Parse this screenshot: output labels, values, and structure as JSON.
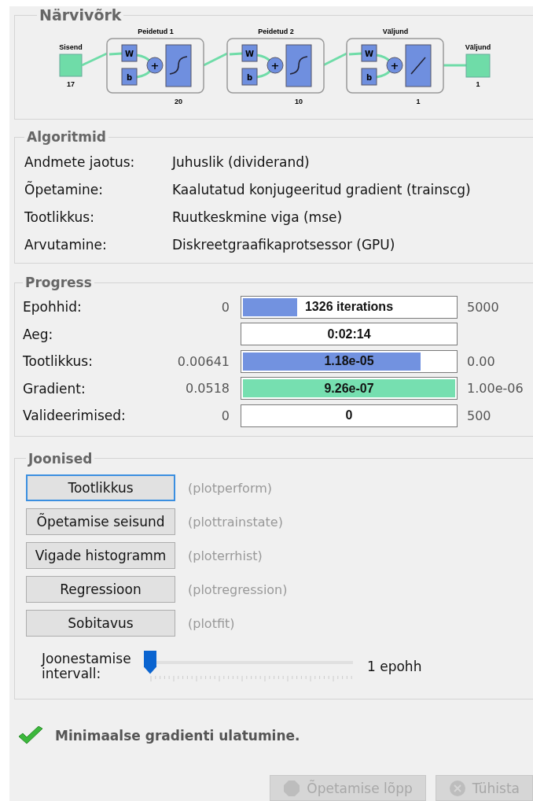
{
  "network": {
    "title": "Närvivõrk",
    "input": {
      "label": "Sisend",
      "size": "17"
    },
    "layers": [
      {
        "title": "Peidetud 1",
        "size": "20",
        "kind": "sigmoid",
        "weight": "W",
        "bias": "b",
        "sum": "+"
      },
      {
        "title": "Peidetud 2",
        "size": "10",
        "kind": "sigmoid",
        "weight": "W",
        "bias": "b",
        "sum": "+"
      },
      {
        "title": "Väljund",
        "size": "1",
        "kind": "linear",
        "weight": "W",
        "bias": "b",
        "sum": "+"
      }
    ],
    "output": {
      "label": "Väljund",
      "size": "1"
    }
  },
  "algorithms": {
    "title": "Algoritmid",
    "rows": [
      {
        "label": "Andmete jaotus:",
        "value": "Juhuslik (dividerand)"
      },
      {
        "label": "Õpetamine:",
        "value": "Kaalutatud konjugeeritud gradient (trainscg)"
      },
      {
        "label": "Tootlikkus:",
        "value": "Ruutkeskmine viga (mse)"
      },
      {
        "label": "Arvutamine:",
        "value": "Diskreetgraafikaprotsessor (GPU)"
      }
    ]
  },
  "progress": {
    "title": "Progress",
    "rows": [
      {
        "label": "Epohhid:",
        "start": "0",
        "value": "1326 iterations",
        "end": "5000",
        "level": 0.265,
        "color": "#7292e0"
      },
      {
        "label": "Aeg:",
        "value": "0:02:14"
      },
      {
        "label": "Tootlikkus:",
        "start": "0.00641",
        "value": "1.18e-05",
        "end": "0.00",
        "level": 0.84,
        "color": "#7292e0"
      },
      {
        "label": "Gradient:",
        "start": "0.0518",
        "value": "9.26e-07",
        "end": "1.00e-06",
        "level": 1,
        "color": "#76dfb0"
      },
      {
        "label": "Valideerimised:",
        "start": "0",
        "value": "0",
        "end": "500"
      }
    ]
  },
  "plots": {
    "title": "Joonised",
    "buttons": [
      {
        "label": "Tootlikkus",
        "hint": "(plotperform)",
        "focused": true
      },
      {
        "label": "Õpetamise seisund",
        "hint": "(plottrainstate)",
        "focused": false
      },
      {
        "label": "Vigade histogramm",
        "hint": "(ploterrhist)",
        "focused": false
      },
      {
        "label": "Regressioon",
        "hint": "(plotregression)",
        "focused": false
      },
      {
        "label": "Sobitavus",
        "hint": "(plotfit)",
        "focused": false
      }
    ],
    "interval": {
      "label": "Joonestamise intervall:",
      "level": 0,
      "reading": "1 epohh"
    }
  },
  "status": {
    "message": "Minimaalse gradienti ulatumine.",
    "success": true
  },
  "buttons": [
    {
      "label": "Õpetamise lõpp",
      "kind": "stop",
      "disabled": true
    },
    {
      "label": "Tühista",
      "kind": "cancel",
      "disabled": true
    }
  ]
}
